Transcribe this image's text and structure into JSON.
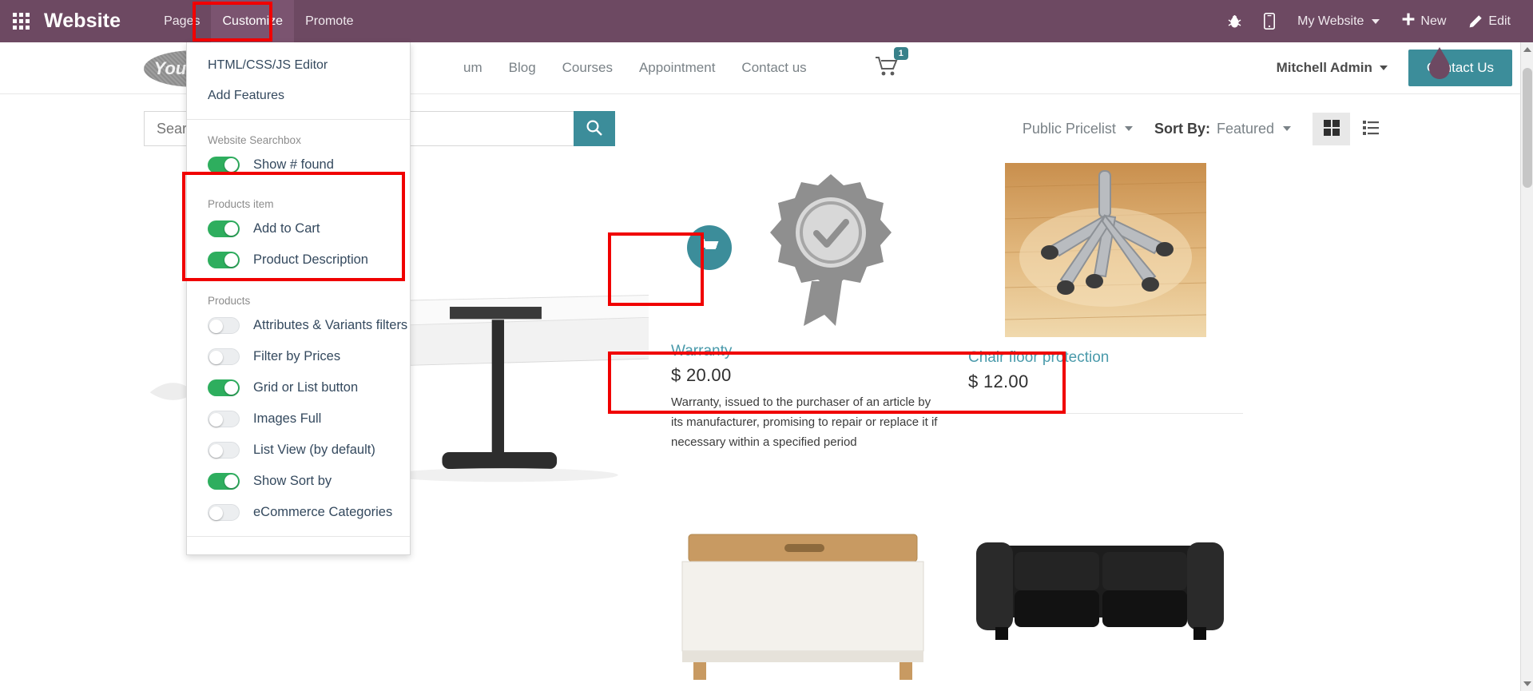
{
  "topbar": {
    "apps_icon": "apps-grid-icon",
    "brand": "Website",
    "menus": [
      {
        "label": "Pages",
        "active": false
      },
      {
        "label": "Customize",
        "active": true
      },
      {
        "label": "Promote",
        "active": false
      }
    ],
    "right": {
      "bug_icon": "bug-icon",
      "mobile_icon": "mobile-preview-icon",
      "website_selector": "My Website",
      "new_label": "New",
      "new_icon": "plus-icon",
      "edit_label": "Edit",
      "edit_icon": "pencil-icon"
    }
  },
  "customize_menu": {
    "top_items": [
      {
        "label": "HTML/CSS/JS Editor"
      },
      {
        "label": "Add Features"
      }
    ],
    "groups": [
      {
        "title": "Website Searchbox",
        "highlighted": false,
        "options": [
          {
            "label": "Show # found",
            "on": true
          }
        ]
      },
      {
        "title": "Products item",
        "highlighted": true,
        "options": [
          {
            "label": "Add to Cart",
            "on": true
          },
          {
            "label": "Product Description",
            "on": true
          }
        ]
      },
      {
        "title": "Products",
        "highlighted": false,
        "options": [
          {
            "label": "Attributes & Variants filters",
            "on": false
          },
          {
            "label": "Filter by Prices",
            "on": false
          },
          {
            "label": "Grid or List button",
            "on": true
          },
          {
            "label": "Images Full",
            "on": false
          },
          {
            "label": "List View (by default)",
            "on": false
          },
          {
            "label": "Show Sort by",
            "on": true
          },
          {
            "label": "eCommerce Categories",
            "on": false
          }
        ]
      }
    ]
  },
  "site_header": {
    "logo_text": "YourLogo",
    "nav": [
      "um",
      "Blog",
      "Courses",
      "Appointment",
      "Contact us"
    ],
    "cart_icon": "shopping-cart-icon",
    "cart_count": "1",
    "user": "Mitchell Admin",
    "cta": "Contact Us"
  },
  "shop_toolbar": {
    "search_placeholder": "Search...",
    "search_value": "",
    "search_icon": "magnifier-icon",
    "pricelist": "Public Pricelist",
    "sort_label": "Sort By:",
    "sort_value": "Featured",
    "view_grid_icon": "grid-view-icon",
    "view_list_icon": "list-view-icon",
    "active_view": "grid"
  },
  "products": [
    {
      "name": "",
      "price": "",
      "description": "",
      "image": "office-desk-photo"
    },
    {
      "name": "Warranty",
      "price": "$ 20.00",
      "description": "Warranty, issued to the purchaser of an article by its manufacturer, promising to repair or replace it if necessary within a specified period",
      "image": "warranty-badge-icon",
      "cart_icon": "add-to-cart-icon"
    },
    {
      "name": "Chair floor protection",
      "price": "$ 12.00",
      "description": "",
      "image": "chair-floor-mat-photo"
    },
    {
      "name": "",
      "price": "",
      "description": "",
      "image": "storage-bench-photo"
    },
    {
      "name": "",
      "price": "",
      "description": "",
      "image": "black-leather-sofa-photo"
    }
  ],
  "colors": {
    "odoo_purple": "#6d4962",
    "accent_teal": "#3c8d9a",
    "toggle_on_green": "#2eae5e",
    "link_blue": "#4a9aab",
    "annotation_red": "#f00000"
  }
}
